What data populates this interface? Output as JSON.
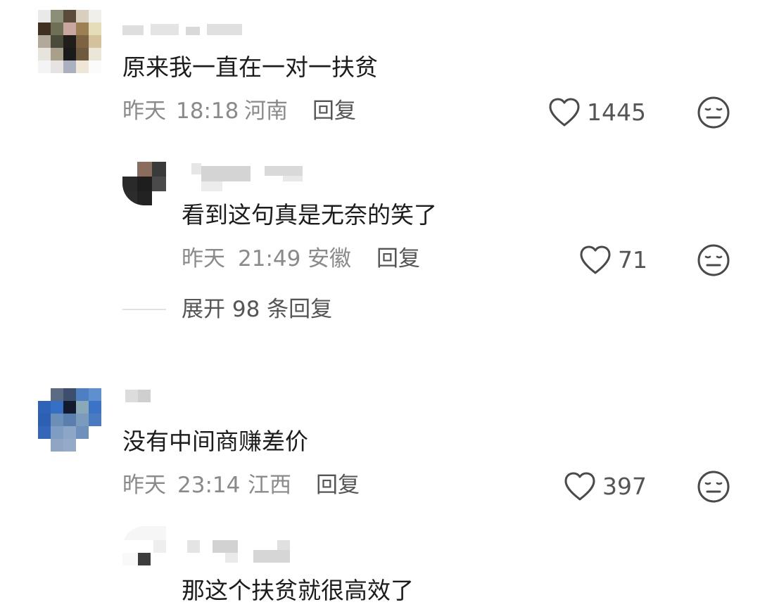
{
  "comments": [
    {
      "text": "原来我一直在一对一扶贫",
      "date": "昨天",
      "time": "18:18",
      "location": "河南",
      "reply_label": "回复",
      "likes": "1445",
      "replies": [
        {
          "text": "看到这句真是无奈的笑了",
          "date": "昨天",
          "time": "21:49",
          "location": "安徽",
          "reply_label": "回复",
          "likes": "71"
        }
      ],
      "expand_label": "展开 98 条回复"
    },
    {
      "text": "没有中间商赚差价",
      "date": "昨天",
      "time": "23:14",
      "location": "江西",
      "reply_label": "回复",
      "likes": "397",
      "replies": [
        {
          "text": "那这个扶贫就很高效了"
        }
      ]
    }
  ],
  "icons": {
    "like": "heart-outline-icon",
    "dislike": "neutral-face-icon"
  },
  "colors": {
    "text": "#1c1c1c",
    "meta": "#8a8a8a",
    "action": "#555555",
    "background": "#ffffff"
  }
}
